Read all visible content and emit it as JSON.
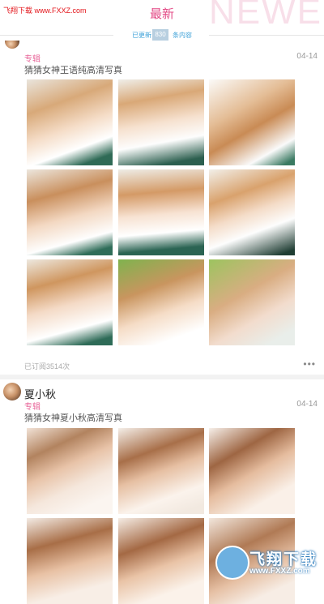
{
  "watermark_top": "飞翔下载 www.FXXZ.com",
  "header": {
    "title": "最新",
    "background_word": "NEWEST"
  },
  "update_bar": {
    "left_text": "已更新",
    "count": "830",
    "right_text": "条内容"
  },
  "posts": [
    {
      "author": "",
      "tag": "专辑",
      "date": "04-14",
      "title": "猜猜女神王语纯高清写真",
      "views": "已订阅3514次",
      "more": "•••"
    },
    {
      "author": "夏小秋",
      "tag": "专辑",
      "date": "04-14",
      "title": "猜猜女神夏小秋高清写真"
    }
  ],
  "watermark_logo": {
    "cn": "飞翔下载",
    "url": "www.FXXZ.com"
  },
  "colors": {
    "accent": "#e34a86",
    "link": "#3fa2d8",
    "text_muted": "#999999"
  }
}
